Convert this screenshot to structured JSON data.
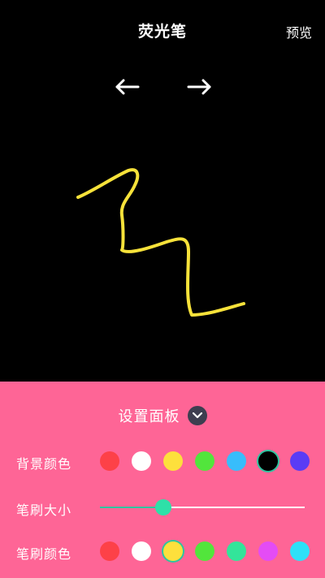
{
  "header": {
    "title": "荧光笔",
    "preview_label": "预览"
  },
  "toolbar": {
    "undo_icon": "arrow-left-icon",
    "redo_icon": "arrow-right-icon"
  },
  "canvas": {
    "background": "#000000",
    "stroke_color": "#f7e23a"
  },
  "panel": {
    "title": "设置面板",
    "toggle_icon": "chevron-down-icon",
    "background": "#fe6596",
    "background_color": {
      "label": "背景颜色",
      "options": [
        "#fd4148",
        "#ffffff",
        "#fde03c",
        "#52e53c",
        "#38bdfb",
        "#000000",
        "#5a3cf5"
      ],
      "selected_index": 5
    },
    "brush_size": {
      "label": "笔刷大小",
      "value_fraction": 0.31
    },
    "brush_color": {
      "label": "笔刷颜色",
      "options": [
        "#fd4148",
        "#ffffff",
        "#fde03c",
        "#52e53c",
        "#33e49a",
        "#e44cf5",
        "#2de0f8"
      ],
      "selected_index": 2
    }
  }
}
